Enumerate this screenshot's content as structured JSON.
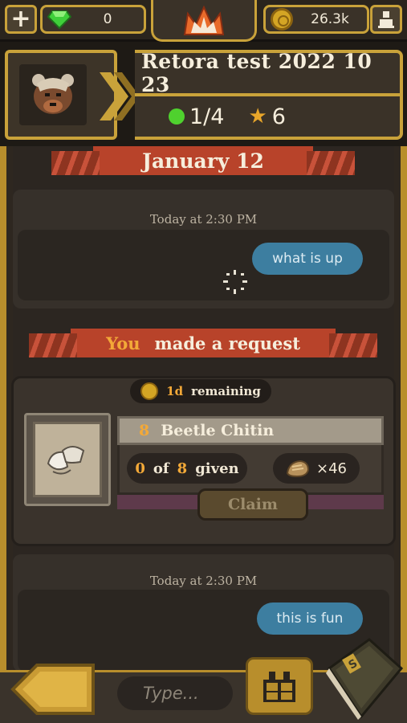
{
  "topbar": {
    "gems": "0",
    "coins": "26.3k",
    "icons": [
      "plus-icon",
      "gem-icon",
      "crown-icon",
      "coin-icon",
      "user-icon"
    ]
  },
  "profile": {
    "name": "Retora test 2022 10 23",
    "progress": "1/4",
    "stars": "6"
  },
  "chat": {
    "date": "January 12",
    "messages": [
      {
        "timestamp": "Today at 2:30 PM",
        "text": "what is up"
      },
      {
        "timestamp": "Today at 2:30 PM",
        "text": "this is fun"
      }
    ],
    "request": {
      "actor": "You",
      "action": "made a request",
      "time_value": "1d",
      "time_label": "remaining",
      "item_qty": "8",
      "item_name": "Beetle Chitin",
      "given": "0",
      "of_label": "of",
      "needed": "8",
      "given_label": "given",
      "reward": "×46",
      "claim_label": "Claim"
    }
  },
  "composer": {
    "placeholder": "Type..."
  },
  "colors": {
    "gold": "#c9a23a",
    "ribbon_red": "#b8432a",
    "bubble_blue": "#3d7ea0",
    "accent_orange": "#f3a938",
    "green": "#4fd12e"
  }
}
